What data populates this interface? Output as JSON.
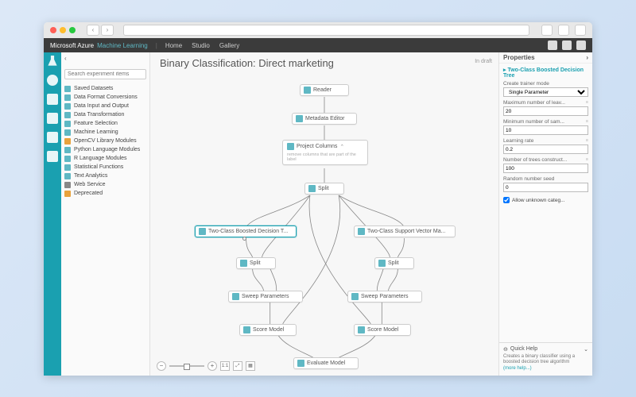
{
  "browser": {
    "back": "‹",
    "fwd": "›"
  },
  "topbar": {
    "brand": "Microsoft Azure",
    "product": "Machine Learning",
    "links": [
      "Home",
      "Studio",
      "Gallery"
    ]
  },
  "sidebar": {
    "collapse": "‹",
    "search_placeholder": "Search experiment items",
    "items": [
      "Saved Datasets",
      "Data Format Conversions",
      "Data Input and Output",
      "Data Transformation",
      "Feature Selection",
      "Machine Learning",
      "OpenCV Library Modules",
      "Python Language Modules",
      "R Language Modules",
      "Statistical Functions",
      "Text Analytics",
      "Web Service",
      "Deprecated"
    ]
  },
  "canvas": {
    "title": "Binary Classification: Direct marketing",
    "status": "In draft",
    "nodes": {
      "reader": "Reader",
      "metadata": "Metadata Editor",
      "project": "Project Columns",
      "project_sub": "remove columns that are part of the label",
      "split0": "Split",
      "bdt": "Two-Class Boosted Decision T...",
      "svm": "Two-Class Support Vector Ma...",
      "split1": "Split",
      "split2": "Split",
      "sweep1": "Sweep Parameters",
      "sweep2": "Sweep Parameters",
      "score1": "Score Model",
      "score2": "Score Model",
      "eval": "Evaluate Model"
    },
    "zoom": {
      "fit": "1:1"
    }
  },
  "props": {
    "header": "Properties",
    "title": "Two-Class Boosted Decision Tree",
    "trainer_label": "Create trainer mode",
    "trainer_value": "Single Parameter",
    "maxleaves_label": "Maximum number of leav...",
    "maxleaves_value": "20",
    "minsamples_label": "Minimum number of sam...",
    "minsamples_value": "10",
    "lr_label": "Learning rate",
    "lr_value": "0.2",
    "trees_label": "Number of trees construct...",
    "trees_value": "100",
    "seed_label": "Random number seed",
    "seed_value": "0",
    "allow_label": "Allow unknown categ...",
    "quickhelp": "Quick Help",
    "quickdesc": "Creates a binary classifier using a boosted decision tree algorithm",
    "more": "(more help...)"
  }
}
